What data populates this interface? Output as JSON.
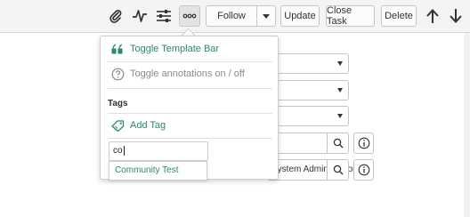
{
  "toolbar": {
    "icons": [
      "attachment-icon",
      "activity-icon",
      "settings-sliders-icon",
      "more-options-icon"
    ],
    "follow_label": "Follow",
    "update_label": "Update",
    "close_task_label": "Close Task",
    "delete_label": "Delete"
  },
  "menu": {
    "toggle_template_bar": "Toggle Template Bar",
    "toggle_annotations": "Toggle annotations on / off",
    "tags_heading": "Tags",
    "add_tag": "Add Tag",
    "tag_input_value": "co",
    "suggestion": "Community Test"
  },
  "form": {
    "field4_value": "",
    "field5_value": "System Administrator"
  },
  "colors": {
    "accent": "#2b8a66",
    "muted_icon": "#8a8a8a",
    "toolbar_bg": "#f4f4f4"
  }
}
